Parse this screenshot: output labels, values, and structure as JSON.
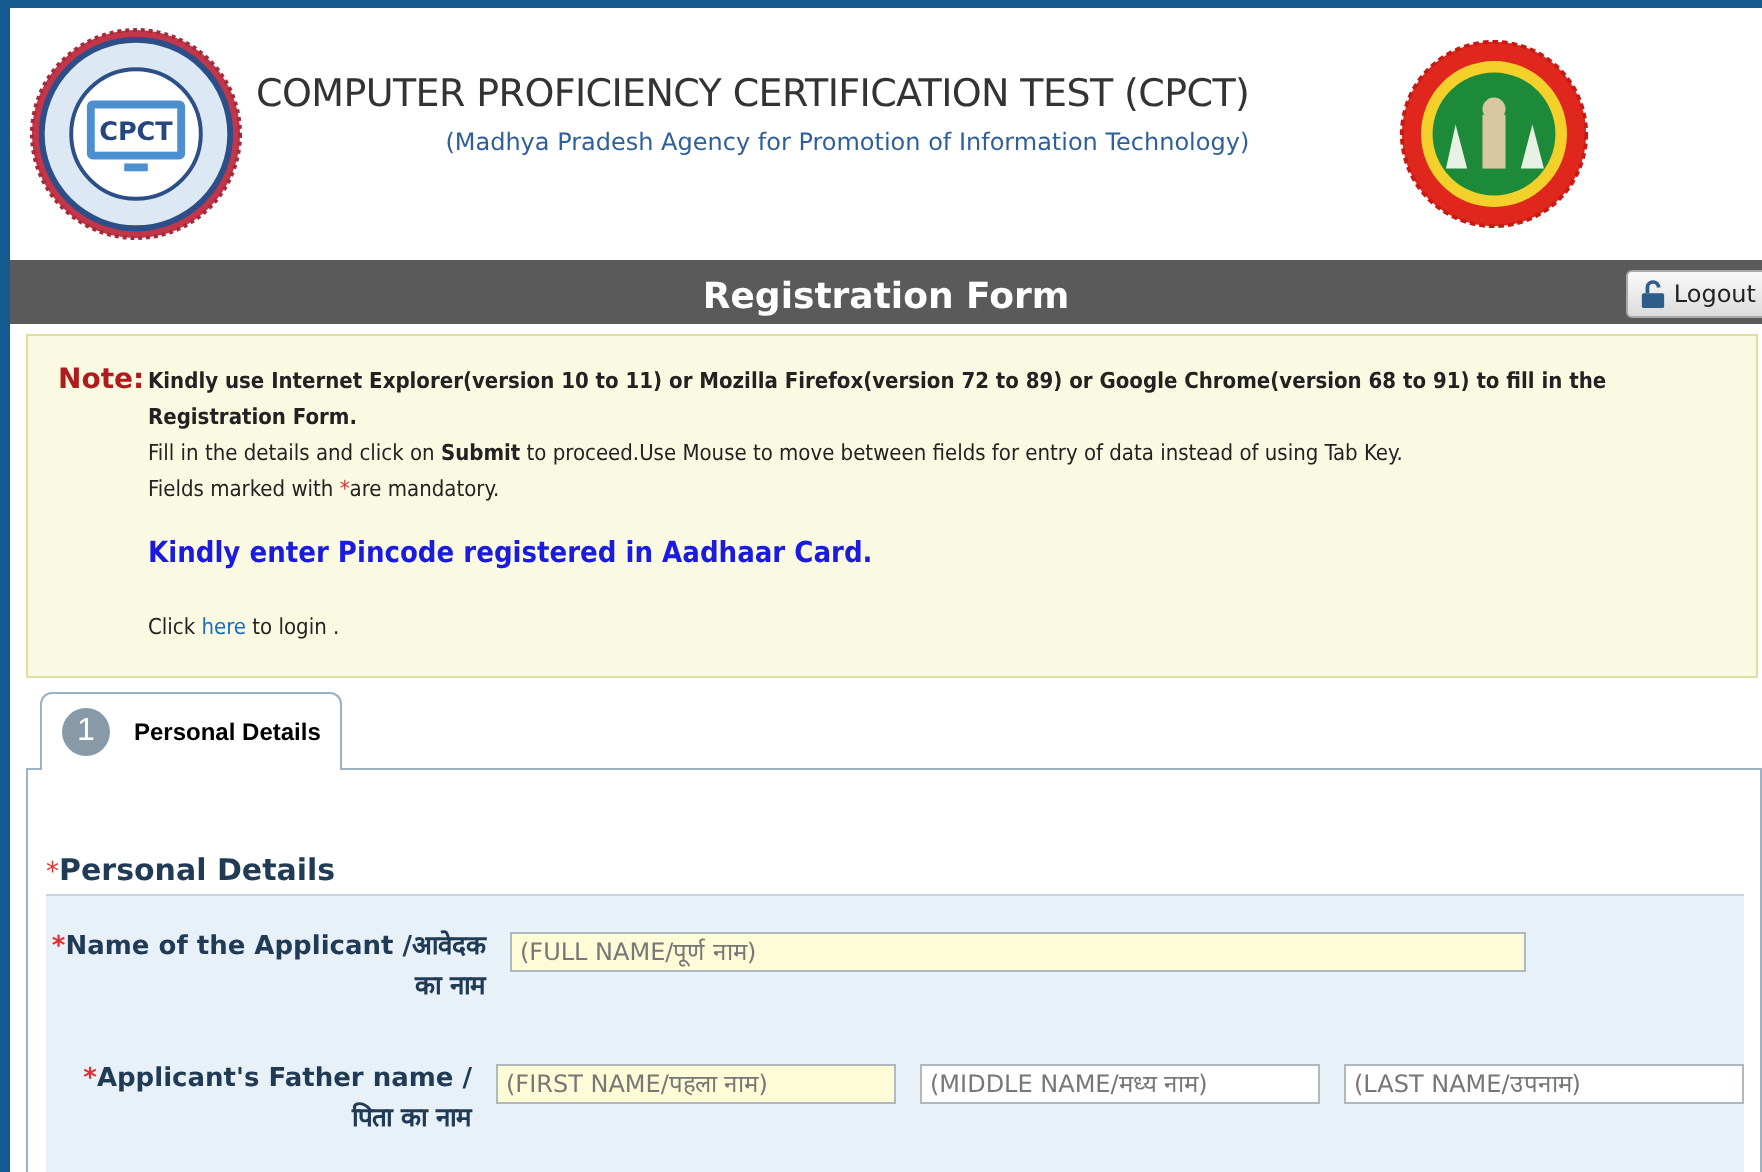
{
  "header": {
    "logo_text": "CPCT",
    "title": "COMPUTER PROFICIENCY CERTIFICATION TEST (CPCT)",
    "subtitle": "(Madhya Pradesh Agency for Promotion of Information Technology)"
  },
  "title_bar": {
    "title": "Registration Form",
    "logout": "Logout"
  },
  "note": {
    "label": "Note:",
    "lines": [
      "Kindly use Internet Explorer(version 10 to 11) or Mozilla Firefox(version 72 to 89) or Google Chrome(version 68 to 91) to fill in the Registration Form.",
      "Fill in the details and click on **Submit** to proceed.Use Mouse to move between fields for entry of data instead of using Tab Key."
    ],
    "mandatory": {
      "before": "Fields marked with ",
      "mark": "*",
      "after": "are mandatory."
    },
    "pincode": "Kindly enter Pincode registered in Aadhaar Card.",
    "login": {
      "before": "Click ",
      "link": "here",
      "after": " to login ."
    }
  },
  "tabs": [
    {
      "number": "1",
      "label": "Personal Details",
      "selected": true
    }
  ],
  "section": {
    "mark": "*",
    "title": "Personal Details"
  },
  "fields": [
    {
      "mark": "*",
      "label": "Name of the Applicant /आवेदक का नाम",
      "inputs": [
        {
          "placeholder": "(FULL NAME/पूर्ण नाम)",
          "required": true
        }
      ]
    },
    {
      "mark": "*",
      "label": "Applicant's Father name /पिता का नाम",
      "inputs": [
        {
          "placeholder": "(FIRST NAME/पहला नाम)",
          "required": true
        },
        {
          "placeholder": "(MIDDLE NAME/मध्य नाम)",
          "required": false
        },
        {
          "placeholder": "(LAST NAME/उपनाम)",
          "required": false
        }
      ]
    }
  ]
}
